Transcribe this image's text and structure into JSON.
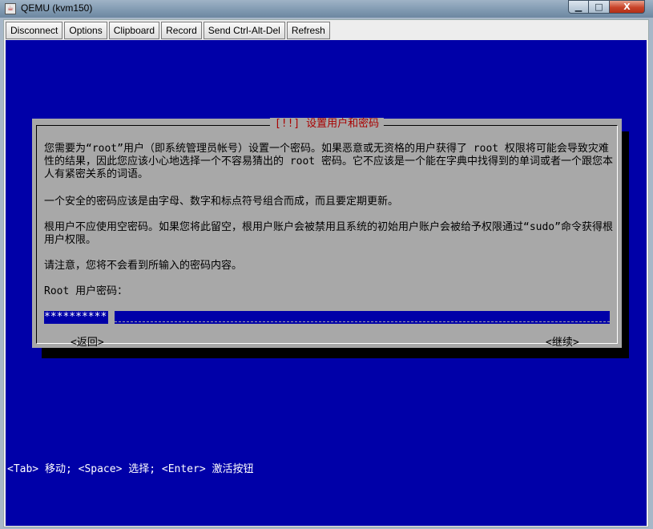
{
  "window": {
    "title": "QEMU (kvm150)",
    "app_icon": "java-cup-icon",
    "controls": {
      "minimize_glyph": "▁",
      "maximize_glyph": "□",
      "close_glyph": "X"
    }
  },
  "toolbar": {
    "buttons": [
      "Disconnect",
      "Options",
      "Clipboard",
      "Record",
      "Send Ctrl-Alt-Del",
      "Refresh"
    ]
  },
  "dialog": {
    "title": "[!!] 设置用户和密码",
    "paragraph1": "您需要为“root”用户（即系统管理员帐号）设置一个密码。如果恶意或无资格的用户获得了 root 权限将可能会导致灾难性的结果，因此您应该小心地选择一个不容易猜出的 root 密码。它不应该是一个能在字典中找得到的单词或者一个跟您本人有紧密关系的词语。",
    "paragraph2": "一个安全的密码应该是由字母、数字和标点符号组合而成，而且要定期更新。",
    "paragraph3": "根用户不应使用空密码。如果您将此留空，根用户账户会被禁用且系统的初始用户账户会被给予权限通过“sudo”命令获得根用户权限。",
    "paragraph4": "请注意，您将不会看到所输入的密码内容。",
    "field_label": "Root 用户密码：",
    "password_mask": "**********",
    "back_button": "<返回>",
    "continue_button": "<继续>"
  },
  "statusline": "<Tab> 移动; <Space> 选择; <Enter> 激活按钮",
  "colors": {
    "console_bg": "#0000a8",
    "dialog_bg": "#a8a8a8",
    "title_red": "#a80000"
  }
}
